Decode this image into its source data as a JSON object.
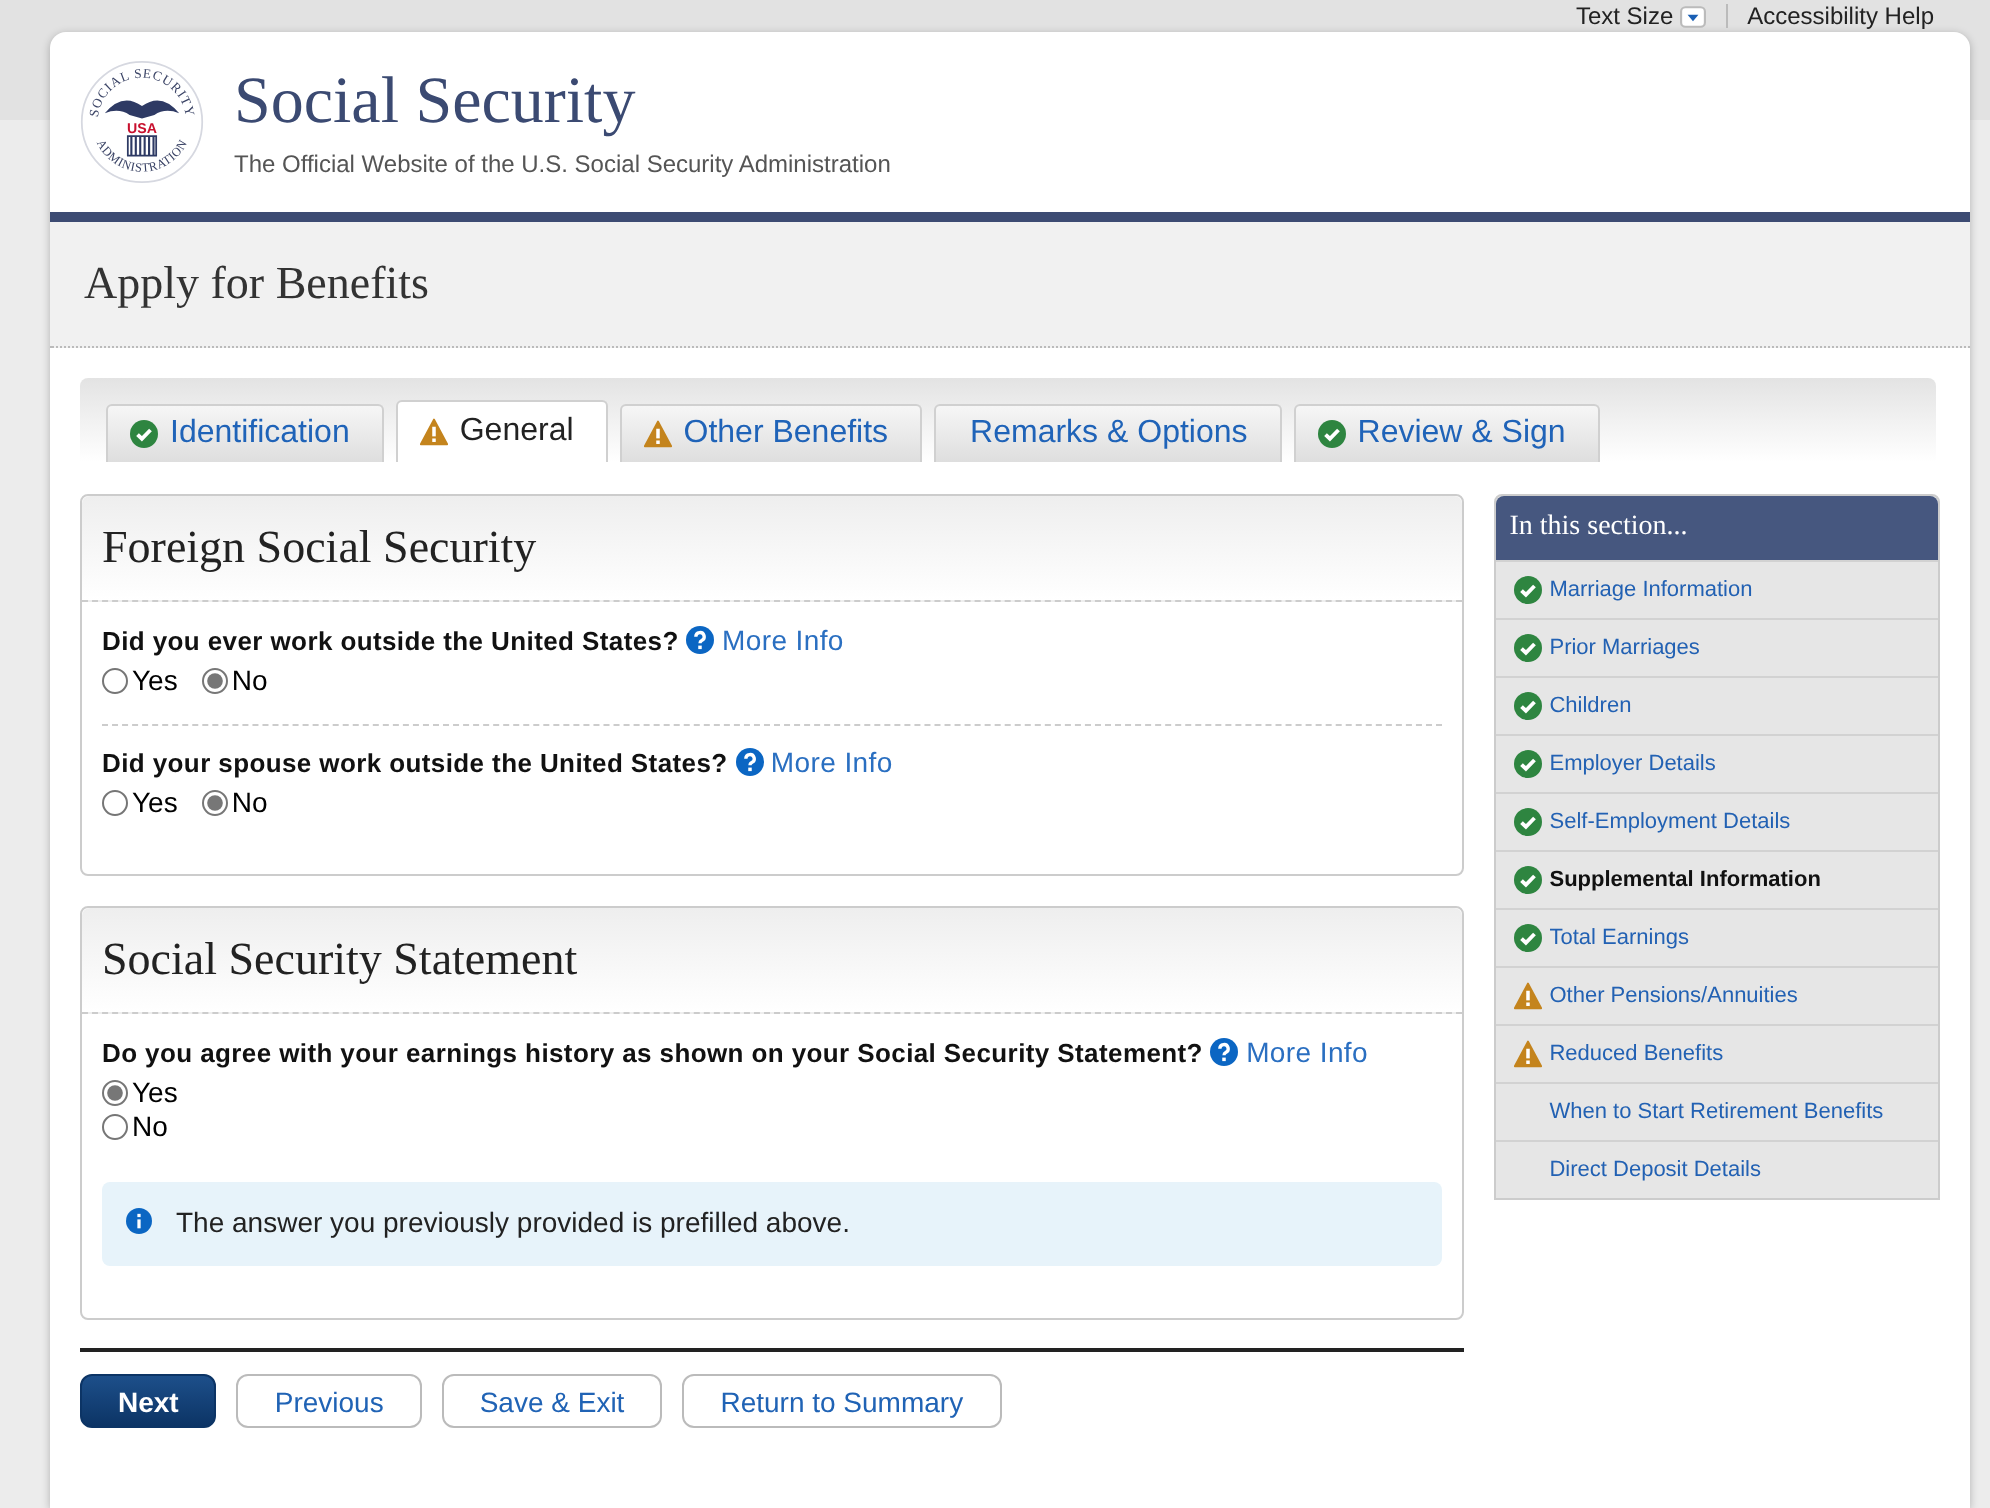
{
  "top_links": [
    {
      "label": "Text Size",
      "kind": "dropdown"
    },
    {
      "label": "Accessibility Help",
      "kind": "link"
    }
  ],
  "logo": {
    "ring_top": "SOCIAL SECURITY",
    "center": "USA",
    "ring_bottom": "ADMINISTRATION"
  },
  "site": {
    "title": "Social Security",
    "subtitle": "The Official Website of the U.S. Social Security Administration"
  },
  "page_title": "Apply for Benefits",
  "tabs": [
    {
      "label": "Identification",
      "kind": "complete",
      "selected": false
    },
    {
      "label": "General",
      "kind": "warning",
      "selected": true
    },
    {
      "label": "Other Benefits",
      "kind": "warning",
      "selected": false
    },
    {
      "label": "Remarks & Options",
      "kind": "none",
      "selected": false
    },
    {
      "label": "Review & Sign",
      "kind": "complete",
      "selected": false
    }
  ],
  "sections": [
    {
      "title": "Foreign Social Security",
      "questions": [
        {
          "text": "Did you ever work outside the United States?",
          "more_info": "More Info",
          "kind": "inline",
          "options": [
            {
              "label": "Yes",
              "selected": false
            },
            {
              "label": "No",
              "selected": true
            }
          ]
        },
        {
          "text": "Did your spouse work outside the United States?",
          "more_info": "More Info",
          "kind": "inline",
          "options": [
            {
              "label": "Yes",
              "selected": false
            },
            {
              "label": "No",
              "selected": true
            }
          ]
        }
      ]
    },
    {
      "title": "Social Security Statement",
      "questions": [
        {
          "text": "Do you agree with your earnings history as shown on your Social Security Statement?",
          "more_info": "More Info",
          "kind": "stacked",
          "options": [
            {
              "label": "Yes",
              "selected": true
            },
            {
              "label": "No",
              "selected": false
            }
          ]
        }
      ],
      "notice": "The answer you previously provided is prefilled above."
    }
  ],
  "sidebar": {
    "title": "In this section...",
    "items": [
      {
        "label": "Marriage Information",
        "kind": "complete",
        "selected": false
      },
      {
        "label": "Prior Marriages",
        "kind": "complete",
        "selected": false
      },
      {
        "label": "Children",
        "kind": "complete",
        "selected": false
      },
      {
        "label": "Employer Details",
        "kind": "complete",
        "selected": false
      },
      {
        "label": "Self-Employment Details",
        "kind": "complete",
        "selected": false
      },
      {
        "label": "Supplemental Information",
        "kind": "complete",
        "selected": true
      },
      {
        "label": "Total Earnings",
        "kind": "complete",
        "selected": false
      },
      {
        "label": "Other Pensions/Annuities",
        "kind": "warning",
        "selected": false
      },
      {
        "label": "Reduced Benefits",
        "kind": "warning",
        "selected": false
      },
      {
        "label": "When to Start Retirement Benefits",
        "kind": "none",
        "selected": false
      },
      {
        "label": "Direct Deposit Details",
        "kind": "none",
        "selected": false
      }
    ]
  },
  "buttons": [
    {
      "label": "Next",
      "kind": "primary"
    },
    {
      "label": "Previous",
      "kind": "secondary"
    },
    {
      "label": "Save & Exit",
      "kind": "secondary"
    },
    {
      "label": "Return to Summary",
      "kind": "secondary"
    }
  ]
}
